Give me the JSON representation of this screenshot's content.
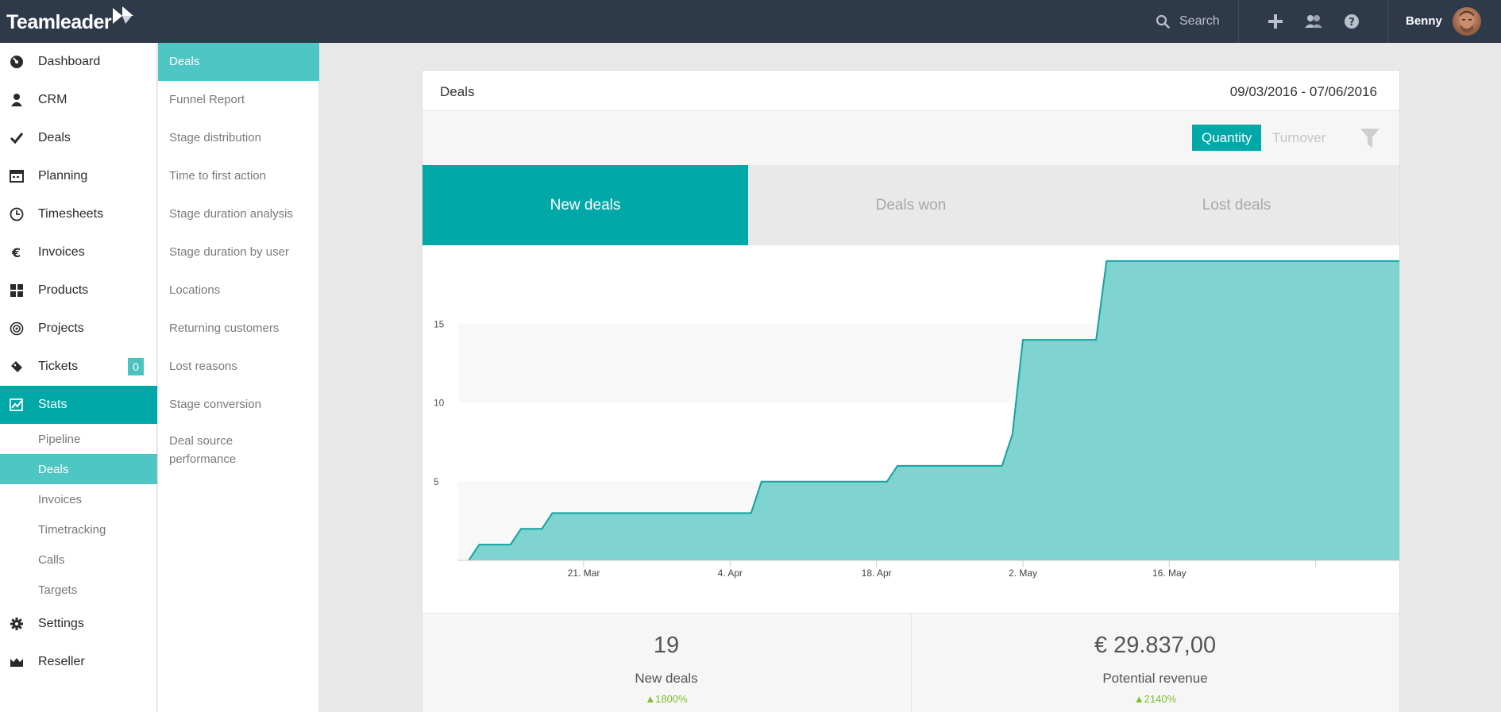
{
  "app": {
    "logo_text": "Teamleader",
    "search_placeholder": "Search",
    "user_name": "Benny"
  },
  "sidebar": {
    "items": [
      {
        "label": "Dashboard",
        "icon": "dashboard-icon"
      },
      {
        "label": "CRM",
        "icon": "person-icon"
      },
      {
        "label": "Deals",
        "icon": "checkmark-icon"
      },
      {
        "label": "Planning",
        "icon": "calendar-icon"
      },
      {
        "label": "Timesheets",
        "icon": "clock-icon"
      },
      {
        "label": "Invoices",
        "icon": "euro-icon"
      },
      {
        "label": "Products",
        "icon": "grid-icon"
      },
      {
        "label": "Projects",
        "icon": "target-icon"
      },
      {
        "label": "Tickets",
        "icon": "ticket-icon",
        "badge": "0"
      },
      {
        "label": "Stats",
        "icon": "stats-icon",
        "active": true
      },
      {
        "label": "Settings",
        "icon": "gear-icon"
      },
      {
        "label": "Reseller",
        "icon": "crown-icon"
      }
    ],
    "stats_sub": [
      {
        "label": "Pipeline"
      },
      {
        "label": "Deals",
        "active": true
      },
      {
        "label": "Invoices"
      },
      {
        "label": "Timetracking"
      },
      {
        "label": "Calls"
      },
      {
        "label": "Targets"
      }
    ]
  },
  "subnav": {
    "items": [
      {
        "label": "Deals",
        "active": true
      },
      {
        "label": "Funnel Report"
      },
      {
        "label": "Stage distribution"
      },
      {
        "label": "Time to first action"
      },
      {
        "label": "Stage duration analysis"
      },
      {
        "label": "Stage duration by user"
      },
      {
        "label": "Locations"
      },
      {
        "label": "Returning customers"
      },
      {
        "label": "Lost reasons"
      },
      {
        "label": "Stage conversion"
      },
      {
        "label": "Deal source performance"
      }
    ]
  },
  "card": {
    "title": "Deals",
    "date_range": "09/03/2016 - 07/06/2016",
    "toggle": {
      "quantity": "Quantity",
      "turnover": "Turnover",
      "selected": "Quantity"
    },
    "tabs": [
      {
        "label": "New deals",
        "active": true
      },
      {
        "label": "Deals won"
      },
      {
        "label": "Lost deals"
      }
    ],
    "stats": [
      {
        "value": "19",
        "label": "New deals",
        "change": "▲1800%"
      },
      {
        "value": "€ 29.837,00",
        "label": "Potential revenue",
        "change": "▲2140%"
      }
    ]
  },
  "colors": {
    "accent": "#00a8a7",
    "accent_light": "#4ec6c3",
    "topbar": "#2e3a4a",
    "area_fill": "#7fd3d1",
    "positive": "#7fbf30"
  },
  "chart_data": {
    "type": "area",
    "title": "",
    "xlabel": "",
    "ylabel": "",
    "x_tick_labels": [
      "21. Mar",
      "4. Apr",
      "18. Apr",
      "2. May",
      "16. May"
    ],
    "y_ticks": [
      5,
      10,
      15
    ],
    "ylim": [
      0,
      20
    ],
    "x": [
      "2016-03-10",
      "2016-03-11",
      "2016-03-14",
      "2016-03-15",
      "2016-03-17",
      "2016-03-18",
      "2016-04-06",
      "2016-04-07",
      "2016-04-19",
      "2016-04-20",
      "2016-04-30",
      "2016-05-01",
      "2016-05-02",
      "2016-05-09",
      "2016-05-10",
      "2016-06-07"
    ],
    "series": [
      {
        "values": [
          0,
          1,
          1,
          2,
          2,
          3,
          3,
          5,
          5,
          6,
          6,
          8,
          14,
          14,
          19,
          19
        ]
      }
    ],
    "grid": "alternating horizontal bands"
  }
}
